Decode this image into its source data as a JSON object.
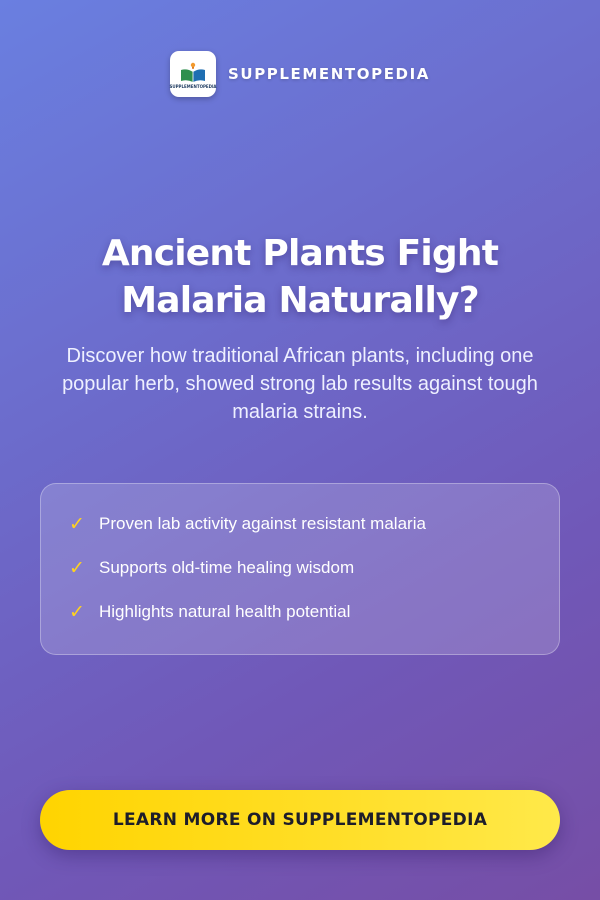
{
  "brand": {
    "logo_text": "SUPPLEMENTOPEDIA",
    "name": "SUPPLEMENTOPEDIA"
  },
  "hero": {
    "headline_line1": "Ancient Plants Fight",
    "headline_line2": "Malaria Naturally?",
    "subhead": "Discover how traditional African plants, including one popular herb, showed strong lab results against tough malaria strains."
  },
  "benefits": [
    {
      "icon": "check-icon",
      "label": "Proven lab activity against resistant malaria"
    },
    {
      "icon": "check-icon",
      "label": "Supports old-time healing wisdom"
    },
    {
      "icon": "check-icon",
      "label": "Highlights natural health potential"
    }
  ],
  "cta": {
    "label": "LEARN MORE ON SUPPLEMENTOPEDIA"
  },
  "colors": {
    "background_top": "#6a7fe0",
    "background_bottom": "#764ea6",
    "accent": "#ffd400",
    "check": "#ffd21f"
  }
}
